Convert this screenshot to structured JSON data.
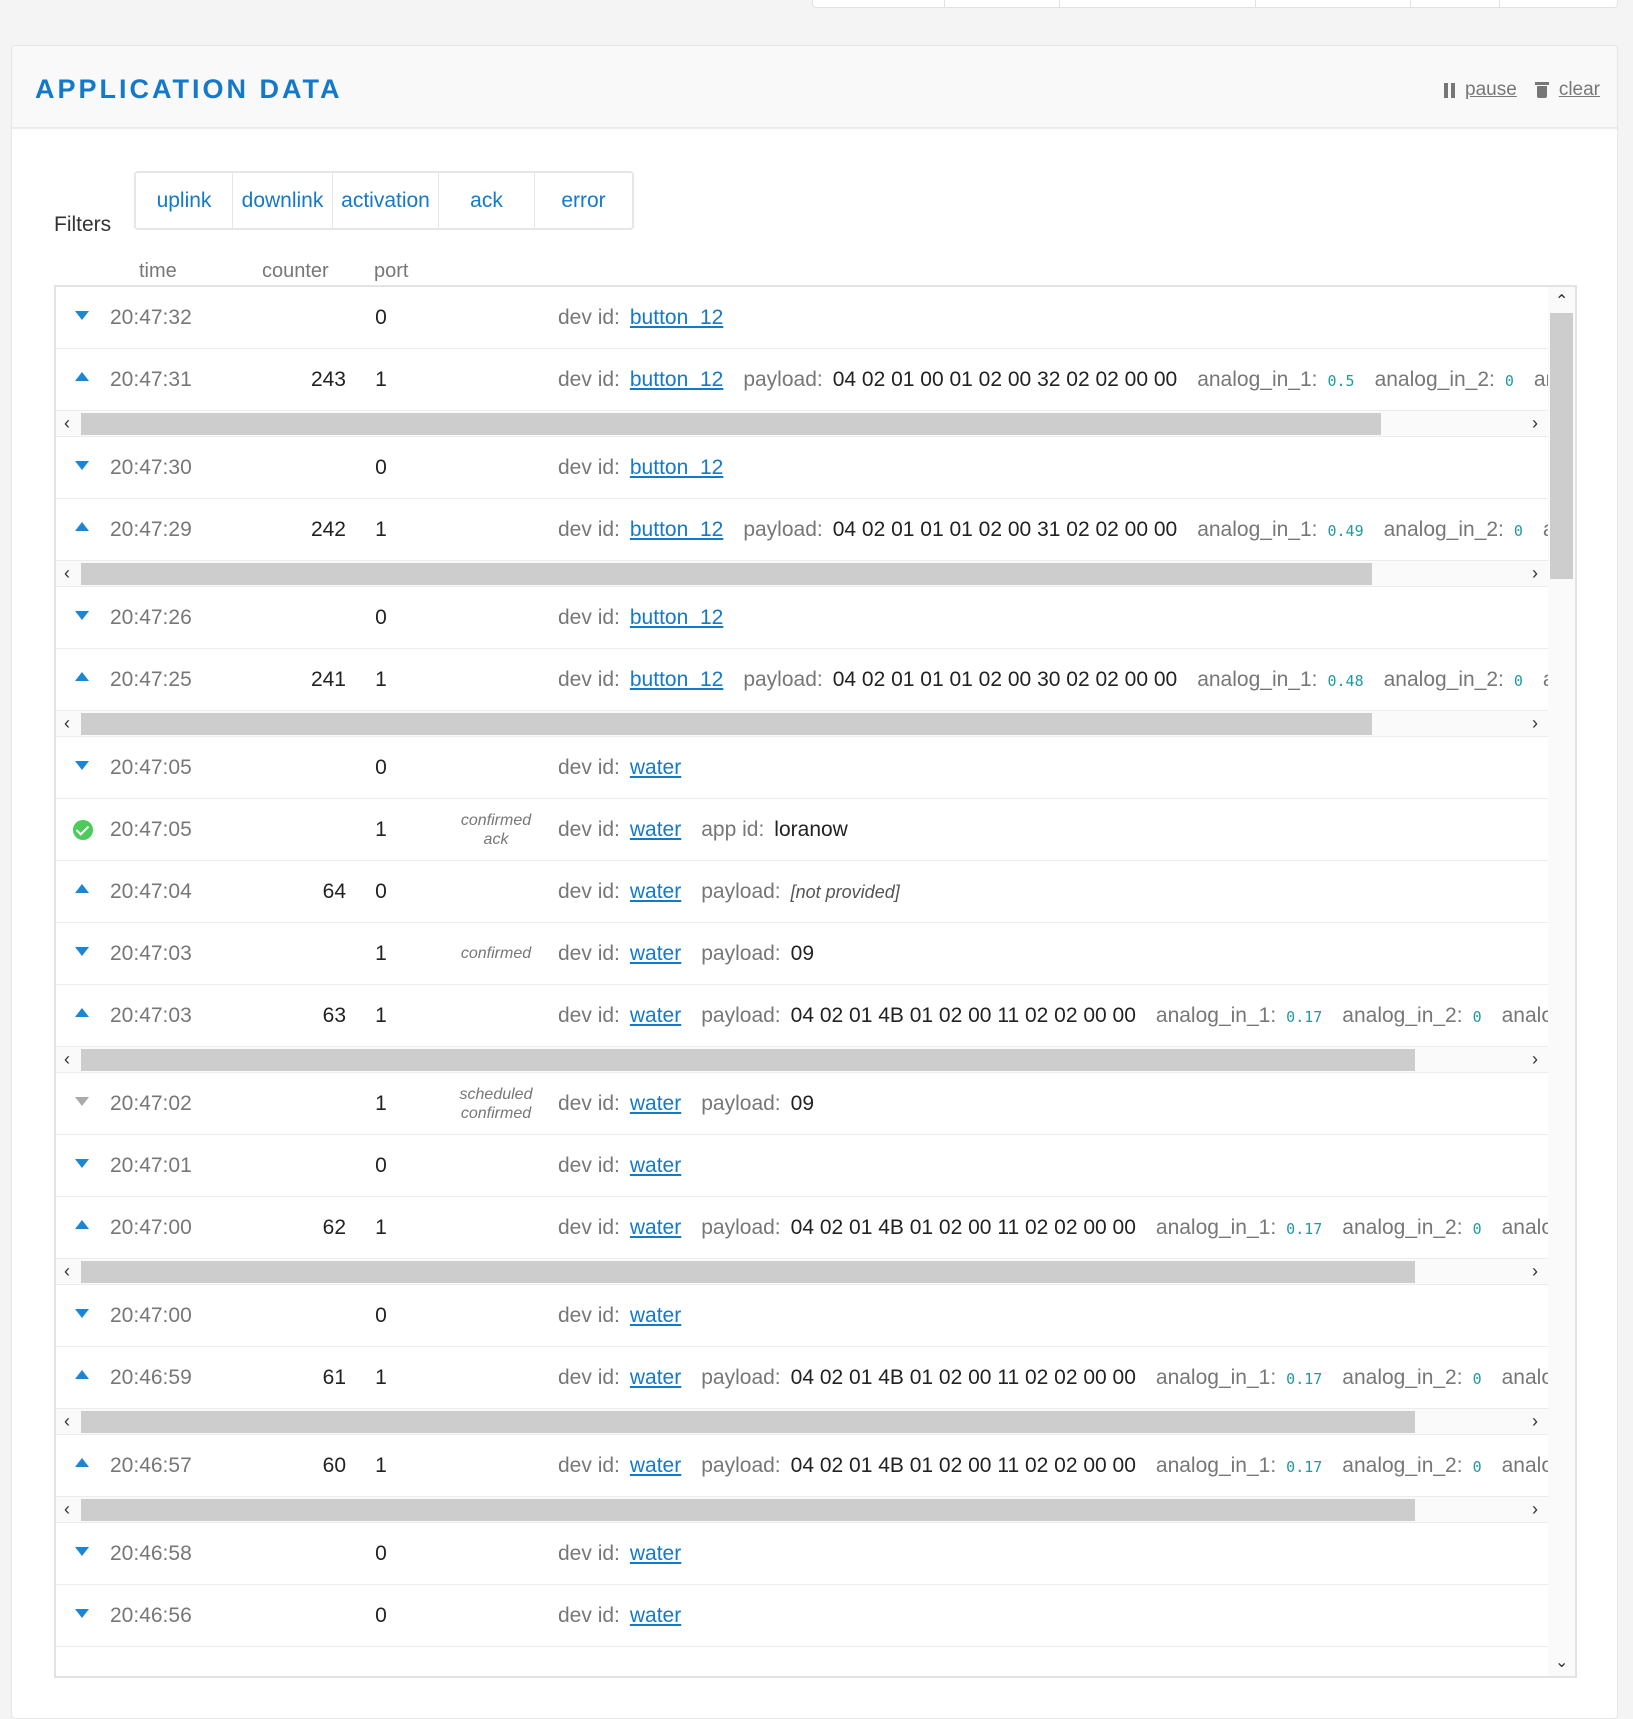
{
  "header": {
    "title": "APPLICATION DATA",
    "pause_label": "pause",
    "clear_label": "clear"
  },
  "filters": {
    "label": "Filters",
    "items": [
      "uplink",
      "downlink",
      "activation",
      "ack",
      "error"
    ]
  },
  "columns": {
    "time": "time",
    "counter": "counter",
    "port": "port"
  },
  "labels": {
    "dev_id": "dev id:",
    "payload": "payload:",
    "app_id": "app id:"
  },
  "icons": {
    "down": "downlink-arrow-icon",
    "up": "uplink-arrow-icon",
    "ack": "ack-check-icon",
    "scheduled": "scheduled-arrow-icon"
  },
  "colors": {
    "accent": "#1479c9",
    "ack": "#4cca5a",
    "value": "#1f9aa0"
  },
  "rows": [
    {
      "kind": "down",
      "time": "20:47:32",
      "counter": "",
      "port": "0",
      "dev_id": "button_12"
    },
    {
      "kind": "up",
      "time": "20:47:31",
      "counter": "243",
      "port": "1",
      "dev_id": "button_12",
      "payload": "04 02 01 00 01 02 00 32 02 02 00 00",
      "extra": [
        [
          "analog_in_1:",
          "0.5"
        ],
        [
          "analog_in_2:",
          "0"
        ],
        [
          "analog",
          ""
        ]
      ],
      "scroll": true,
      "thumb": 0.9
    },
    {
      "kind": "down",
      "time": "20:47:30",
      "counter": "",
      "port": "0",
      "dev_id": "button_12"
    },
    {
      "kind": "up",
      "time": "20:47:29",
      "counter": "242",
      "port": "1",
      "dev_id": "button_12",
      "payload": "04 02 01 01 01 02 00 31 02 02 00 00",
      "extra": [
        [
          "analog_in_1:",
          "0.49"
        ],
        [
          "analog_in_2:",
          "0"
        ],
        [
          "analo",
          ""
        ]
      ],
      "scroll": true,
      "thumb": 0.894
    },
    {
      "kind": "down",
      "time": "20:47:26",
      "counter": "",
      "port": "0",
      "dev_id": "button_12"
    },
    {
      "kind": "up",
      "time": "20:47:25",
      "counter": "241",
      "port": "1",
      "dev_id": "button_12",
      "payload": "04 02 01 01 01 02 00 30 02 02 00 00",
      "extra": [
        [
          "analog_in_1:",
          "0.48"
        ],
        [
          "analog_in_2:",
          "0"
        ],
        [
          "analo",
          ""
        ]
      ],
      "scroll": true,
      "thumb": 0.894
    },
    {
      "kind": "down",
      "time": "20:47:05",
      "counter": "",
      "port": "0",
      "dev_id": "water"
    },
    {
      "kind": "ack",
      "time": "20:47:05",
      "counter": "",
      "port": "1",
      "note": [
        "confirmed",
        "ack"
      ],
      "dev_id": "water",
      "app_id": "loranow"
    },
    {
      "kind": "up",
      "time": "20:47:04",
      "counter": "64",
      "port": "0",
      "dev_id": "water",
      "payload_missing": "[not provided]"
    },
    {
      "kind": "down",
      "time": "20:47:03",
      "counter": "",
      "port": "1",
      "note": [
        "confirmed"
      ],
      "dev_id": "water",
      "payload": "09"
    },
    {
      "kind": "up",
      "time": "20:47:03",
      "counter": "63",
      "port": "1",
      "dev_id": "water",
      "payload": "04 02 01 4B 01 02 00 11 02 02 00 00",
      "extra": [
        [
          "analog_in_1:",
          "0.17"
        ],
        [
          "analog_in_2:",
          "0"
        ],
        [
          "analog_in_",
          ""
        ]
      ],
      "scroll": true,
      "thumb": 0.924
    },
    {
      "kind": "scheduled",
      "time": "20:47:02",
      "counter": "",
      "port": "1",
      "note": [
        "scheduled",
        "confirmed"
      ],
      "dev_id": "water",
      "payload": "09"
    },
    {
      "kind": "down",
      "time": "20:47:01",
      "counter": "",
      "port": "0",
      "dev_id": "water"
    },
    {
      "kind": "up",
      "time": "20:47:00",
      "counter": "62",
      "port": "1",
      "dev_id": "water",
      "payload": "04 02 01 4B 01 02 00 11 02 02 00 00",
      "extra": [
        [
          "analog_in_1:",
          "0.17"
        ],
        [
          "analog_in_2:",
          "0"
        ],
        [
          "analog_in_",
          ""
        ]
      ],
      "scroll": true,
      "thumb": 0.924
    },
    {
      "kind": "down",
      "time": "20:47:00",
      "counter": "",
      "port": "0",
      "dev_id": "water"
    },
    {
      "kind": "up",
      "time": "20:46:59",
      "counter": "61",
      "port": "1",
      "dev_id": "water",
      "payload": "04 02 01 4B 01 02 00 11 02 02 00 00",
      "extra": [
        [
          "analog_in_1:",
          "0.17"
        ],
        [
          "analog_in_2:",
          "0"
        ],
        [
          "analog_in_",
          ""
        ]
      ],
      "scroll": true,
      "thumb": 0.924
    },
    {
      "kind": "up",
      "time": "20:46:57",
      "counter": "60",
      "port": "1",
      "dev_id": "water",
      "payload": "04 02 01 4B 01 02 00 11 02 02 00 00",
      "extra": [
        [
          "analog_in_1:",
          "0.17"
        ],
        [
          "analog_in_2:",
          "0"
        ],
        [
          "analog_in_",
          ""
        ]
      ],
      "scroll": true,
      "thumb": 0.924
    },
    {
      "kind": "down",
      "time": "20:46:58",
      "counter": "",
      "port": "0",
      "dev_id": "water"
    },
    {
      "kind": "down",
      "time": "20:46:56",
      "counter": "",
      "port": "0",
      "dev_id": "water"
    }
  ]
}
